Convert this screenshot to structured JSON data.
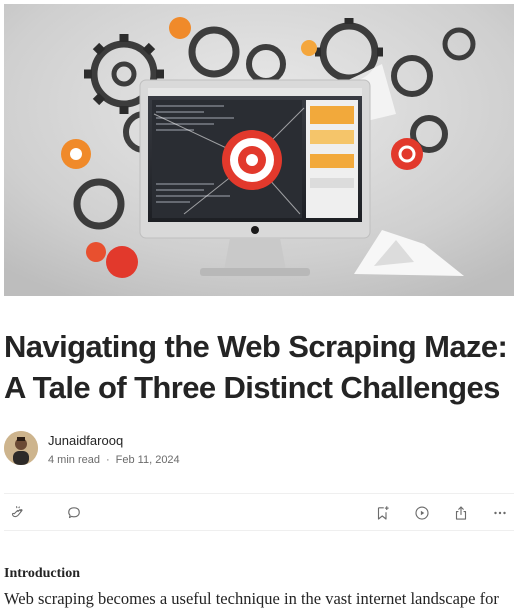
{
  "article": {
    "title": "Navigating the Web Scraping Maze: A Tale of Three Distinct Challenges",
    "author": {
      "name": "Junaidfarooq"
    },
    "meta": {
      "read_time": "4 min read",
      "separator": "·",
      "date": "Feb 11, 2024"
    },
    "actions": {
      "clap": "clap-icon",
      "comment": "comment-icon",
      "save": "bookmark-add-icon",
      "listen": "play-icon",
      "share": "share-icon",
      "more": "more-icon"
    },
    "section_heading": "Introduction",
    "body_excerpt": "Web scraping becomes a useful technique in the vast internet landscape for"
  },
  "colors": {
    "text": "#242424",
    "muted": "#6b6b6b",
    "accent_orange": "#f08a2a",
    "accent_red": "#e2392c"
  }
}
